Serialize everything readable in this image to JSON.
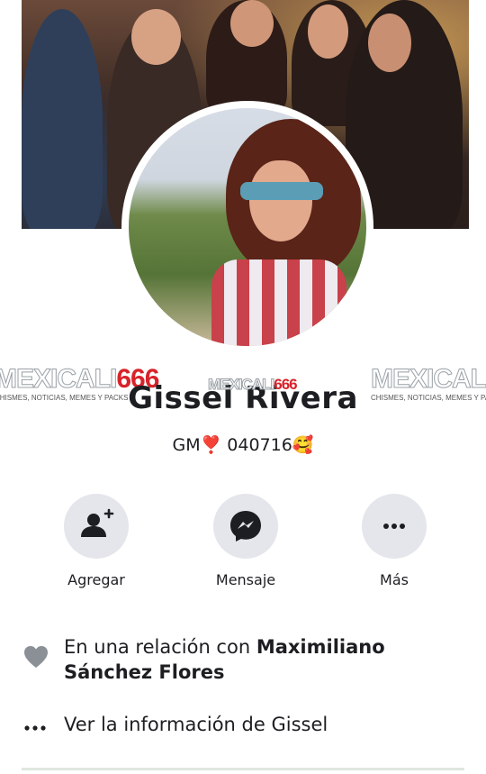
{
  "profile": {
    "name": "Gissel Rivera",
    "bio": "GM❣️ 040716🥰"
  },
  "watermark": {
    "brand_a": "MEXICALI",
    "brand_b": "666",
    "tagline": "CHISMES, NOTICIAS, MEMES Y PACKS"
  },
  "actions": [
    {
      "label": "Agregar",
      "icon": "add-friend-icon"
    },
    {
      "label": "Mensaje",
      "icon": "messenger-icon"
    },
    {
      "label": "Más",
      "icon": "more-icon"
    }
  ],
  "details": {
    "relationship_prefix": "En una relación con ",
    "relationship_partner": "Maximiliano Sánchez Flores",
    "relationship_icon": "heart-icon",
    "about_text": "Ver la información de Gissel",
    "about_icon": "more-icon"
  },
  "colors": {
    "button_bg": "#e4e6eb",
    "icon": "#1c1e21",
    "heart": "#8a9096",
    "brand_red": "#d8232a"
  }
}
